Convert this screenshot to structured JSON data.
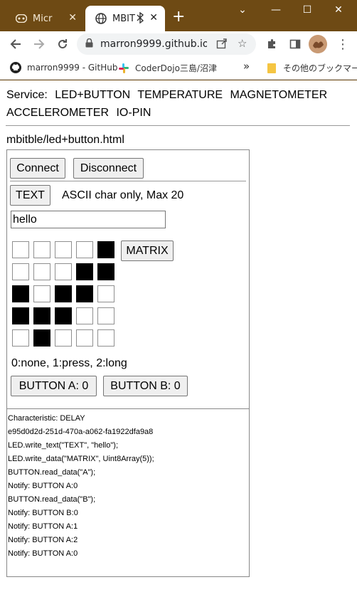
{
  "browser": {
    "tabs": [
      {
        "label": "Micr",
        "icon": "gamepad-icon"
      },
      {
        "label": "MBIT",
        "icon": "globe-icon"
      }
    ],
    "new_tab": "+",
    "window_controls": {
      "dropdown": "⌄",
      "minimize": "—",
      "maximize": "☐",
      "close": "✕"
    },
    "url": "marron9999.github.io...",
    "bookmarks": [
      {
        "label": "marron9999 - GitHub",
        "icon": "github-icon"
      },
      {
        "label": "CoderDojo三島/沼津",
        "icon": "slack-icon"
      }
    ],
    "bookmarks_more": "»",
    "other_bookmarks": "その他のブックマーク"
  },
  "page": {
    "service_prefix": "Service:",
    "services": [
      "LED+BUTTON",
      "TEMPERATURE",
      "MAGNETOMETER",
      "ACCELEROMETER",
      "IO-PIN"
    ],
    "filename": "mbitble/led+button.html",
    "connect": "Connect",
    "disconnect": "Disconnect",
    "text_button": "TEXT",
    "text_hint": "ASCII char only, Max 20",
    "text_value": "hello",
    "matrix_button": "MATRIX",
    "matrix": [
      [
        0,
        0,
        0,
        0,
        1
      ],
      [
        0,
        0,
        0,
        1,
        1
      ],
      [
        1,
        0,
        1,
        1,
        0
      ],
      [
        1,
        1,
        1,
        0,
        0
      ],
      [
        0,
        1,
        0,
        0,
        0
      ]
    ],
    "button_legend": "0:none, 1:press, 2:long",
    "button_a": "BUTTON A: 0",
    "button_b": "BUTTON B: 0",
    "log": [
      "Characteristic: DELAY",
      "e95d0d2d-251d-470a-a062-fa1922dfa9a8",
      "LED.write_text(\"TEXT\", \"hello\");",
      "LED.write_data(\"MATRIX\", Uint8Array(5));",
      "BUTTON.read_data(\"A\");",
      "Notify: BUTTON A:0",
      "BUTTON.read_data(\"B\");",
      "Notify: BUTTON B:0",
      "Notify: BUTTON A:1",
      "Notify: BUTTON A:2",
      "Notify: BUTTON A:0"
    ]
  }
}
